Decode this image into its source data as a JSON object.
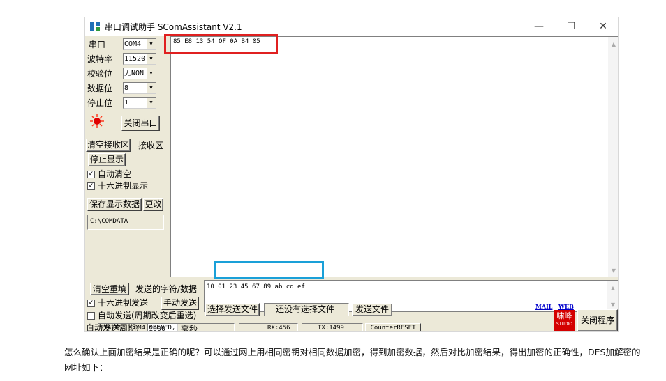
{
  "window": {
    "title": "串口调试助手 SComAssistant V2.1",
    "controls": {
      "minimize": "—",
      "maximize": "☐",
      "close": "✕"
    }
  },
  "serial_settings": {
    "port_label": "串口",
    "port_value": "COM4",
    "baud_label": "波特率",
    "baud_value": "11520",
    "parity_label": "校验位",
    "parity_value": "无NON",
    "databits_label": "数据位",
    "databits_value": "8",
    "stopbits_label": "停止位",
    "stopbits_value": "1",
    "close_port_button": "关闭串口"
  },
  "receive_controls": {
    "clear_receive_button": "清空接收区",
    "receive_tab_label": "接收区",
    "stop_display_button": "停止显示",
    "auto_clear_label": "自动清空",
    "auto_clear_checked": true,
    "hex_display_label": "十六进制显示",
    "hex_display_checked": true,
    "save_data_button": "保存显示数据",
    "change_button": "更改",
    "save_path": "C:\\COMDATA"
  },
  "receive_area": {
    "content": "85 E8 13 54 OF 0A B4 05"
  },
  "send_controls": {
    "clear_resend_button": "清空重填",
    "send_label": "发送的字符/数据",
    "send_content": "10 01 23 45 67 89 ab cd ef",
    "hex_send_label": "十六进制发送",
    "hex_send_checked": true,
    "manual_send_button": "手动发送",
    "auto_send_label": "自动发送(周期改变后重选)",
    "auto_send_checked": false,
    "auto_period_label": "自动发送周期:",
    "auto_period_value": "1000",
    "ms_label": "毫秒",
    "select_file_button": "选择发送文件",
    "no_file_label": "还没有选择文件",
    "send_file_button": "发送文件",
    "mail_link": "MAIL",
    "web_link": "WEB",
    "logo_text": "啸峰",
    "logo_sub": "STUDIO",
    "close_program_button": "关闭程序"
  },
  "status_bar": {
    "status": "STATUS: COM4 OPENED,",
    "rx": "RX:456",
    "tx": "TX:1499",
    "counter_reset": "CounterRESET"
  },
  "caption": "怎么确认上面加密结果是正确的呢？可以通过网上用相同密钥对相同数据加密，得到加密数据，然后对比加密结果，得出加密的正确性，DES加解密的网址如下："
}
